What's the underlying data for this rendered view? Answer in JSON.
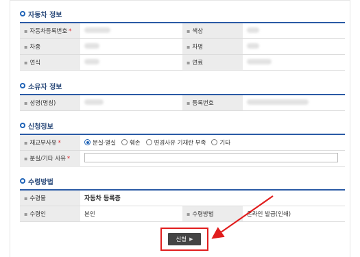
{
  "vehicle_section": {
    "title": "자동차 정보",
    "labels": [
      "자동차등록번호",
      "색상",
      "차종",
      "차명",
      "연식",
      "연료"
    ]
  },
  "owner_section": {
    "title": "소유자 정보",
    "labels": [
      "성명(명칭)",
      "등록번호"
    ]
  },
  "request_section": {
    "title": "신청정보",
    "reissue_label": "재교부사유",
    "options": [
      "분실·멸실",
      "훼손",
      "변경사유 기재란 부족",
      "기타"
    ],
    "selected_option": "분실·멸실",
    "reason_label": "분실/기타 사유",
    "reason_value": ""
  },
  "receipt_section": {
    "title": "수령방법",
    "item_label": "수령물",
    "item_value": "자동차 등록증",
    "receiver_label": "수령인",
    "receiver_value": "본인",
    "method_label": "수령방법",
    "method_value": "온라인 발급(인쇄)"
  },
  "apply_button": {
    "label": "신청"
  },
  "colors": {
    "section_blue": "#1f63b7",
    "highlight_red": "#e11d1d",
    "label_bg": "#ececec"
  }
}
